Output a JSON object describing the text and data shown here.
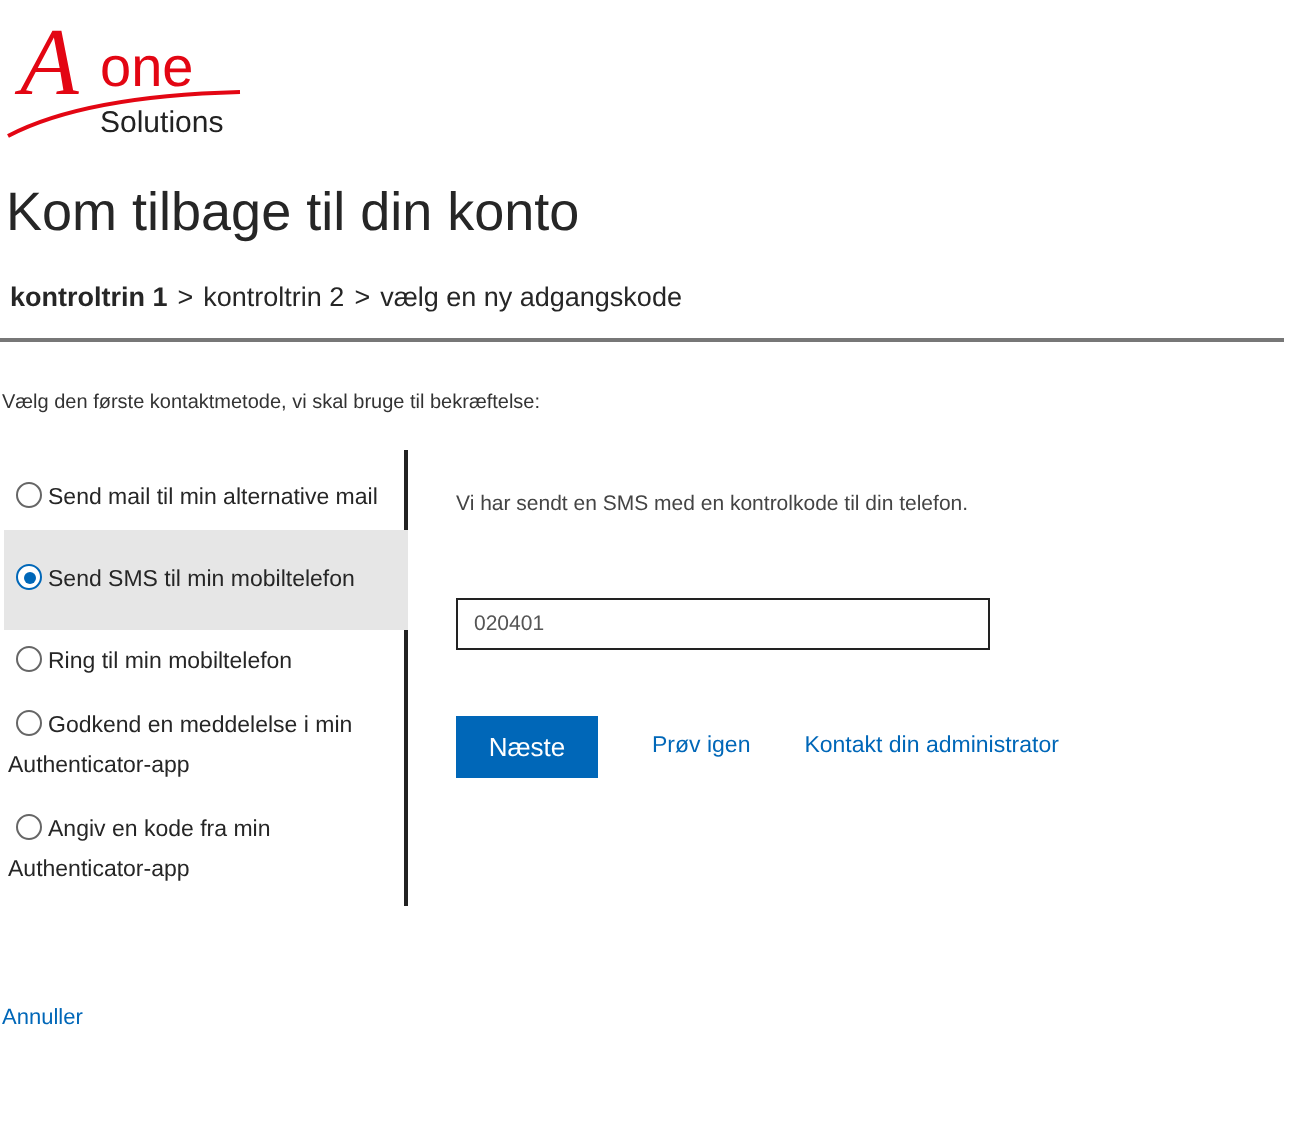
{
  "logo": {
    "letter": "A",
    "word": "one",
    "subtitle": "Solutions"
  },
  "title": "Kom tilbage til din konto",
  "breadcrumb": [
    {
      "label": "kontroltrin 1",
      "selected": true
    },
    {
      "label": "kontroltrin 2",
      "selected": false
    },
    {
      "label": "vælg en ny adgangskode",
      "selected": false
    }
  ],
  "separator": ">",
  "instruction": "Vælg den første kontaktmetode, vi skal bruge til bekræftelse:",
  "methods": [
    {
      "label": "Send mail til min alternative mail",
      "selected": false
    },
    {
      "label": "Send SMS til min mobiltelefon",
      "selected": true
    },
    {
      "label": "Ring til min mobiltelefon",
      "selected": false
    },
    {
      "label": "Godkend en meddelelse i min Authenticator-app",
      "selected": false
    },
    {
      "label": "Angiv en kode fra min Authenticator-app",
      "selected": false
    }
  ],
  "message": "Vi har sendt en SMS med en kontrolkode til din telefon.",
  "code_field": {
    "value": "020401"
  },
  "next_button": "Næste",
  "links": [
    "Prøv igen",
    "Kontakt din administrator"
  ],
  "cancel": "Annuller"
}
